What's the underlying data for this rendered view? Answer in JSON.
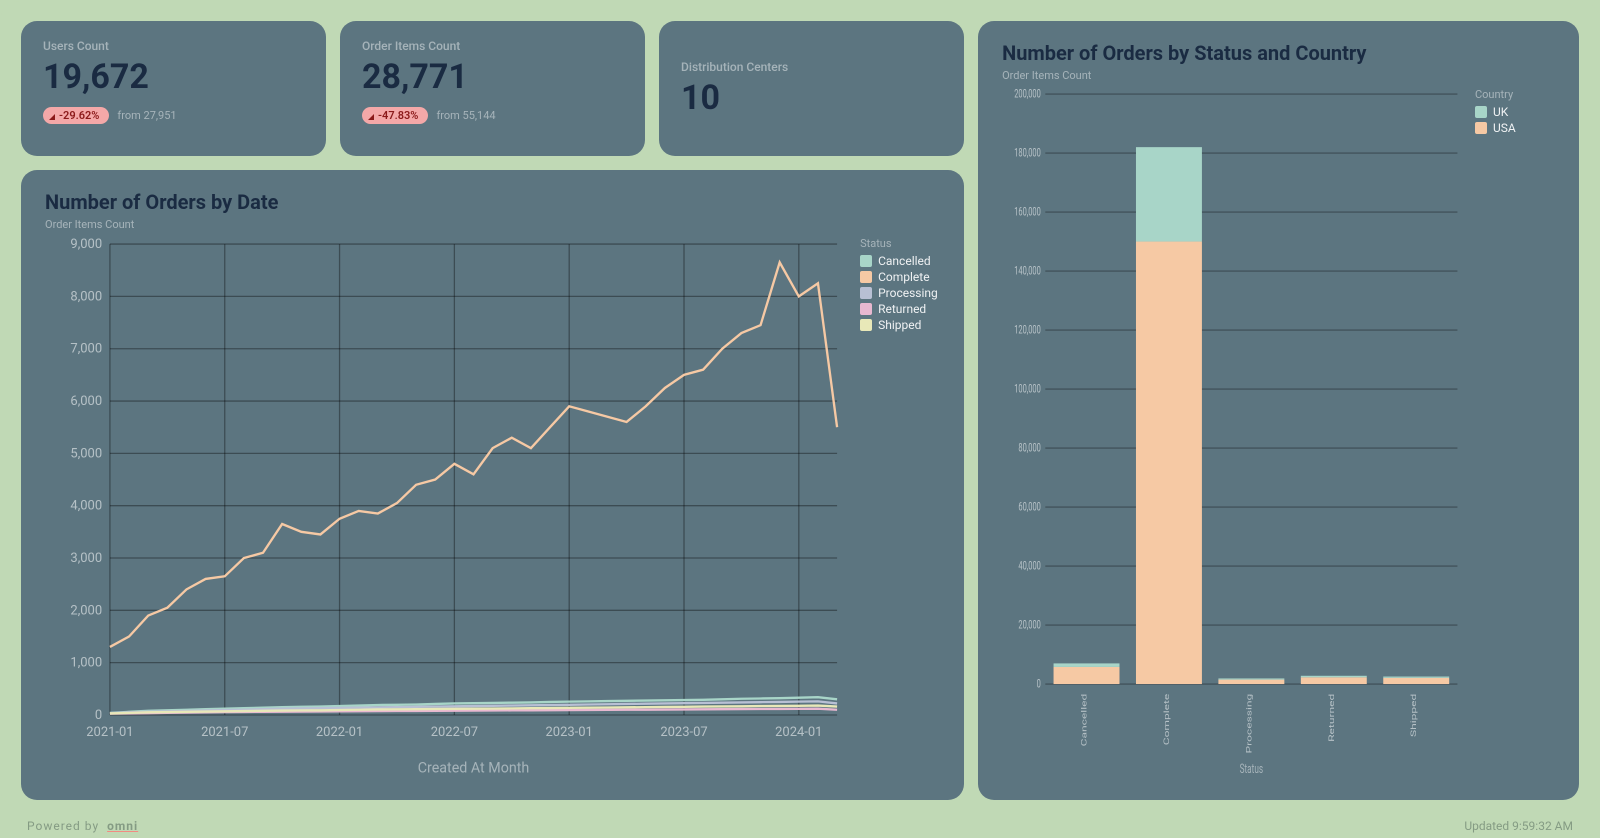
{
  "kpi1": {
    "label": "Users Count",
    "value": "19,672",
    "delta": "-29.62%",
    "from": "from 27,951"
  },
  "kpi2": {
    "label": "Order Items Count",
    "value": "28,771",
    "delta": "-47.83%",
    "from": "from 55,144"
  },
  "kpi3": {
    "label": "Distribution Centers",
    "value": "10"
  },
  "line": {
    "title": "Number of Orders by Date",
    "subtitle": "Order Items Count",
    "xlabel": "Created At Month",
    "legend_title": "Status",
    "legend": [
      "Cancelled",
      "Complete",
      "Processing",
      "Returned",
      "Shipped"
    ]
  },
  "bar": {
    "title": "Number of Orders by Status and Country",
    "subtitle": "Order Items Count",
    "xlabel": "Status",
    "legend_title": "Country",
    "legend": [
      "UK",
      "USA"
    ]
  },
  "footer": {
    "powered": "Powered by",
    "brand": "omni",
    "updated": "Updated 9:59:32 AM"
  },
  "colors": {
    "cancelled": "#a8d5c8",
    "complete": "#f6c9a4",
    "processing": "#b8c0d4",
    "returned": "#e8b8d0",
    "shipped": "#e8e8b8",
    "uk": "#a8d5c8",
    "usa": "#f6c9a4"
  },
  "chart_data": [
    {
      "type": "line",
      "title": "Number of Orders by Date",
      "xlabel": "Created At Month",
      "ylabel": "Order Items Count",
      "ylim": [
        0,
        9000
      ],
      "y_ticks": [
        0,
        1000,
        2000,
        3000,
        4000,
        5000,
        6000,
        7000,
        8000,
        9000
      ],
      "x_ticks": [
        "2021-01",
        "2021-07",
        "2022-01",
        "2022-07",
        "2023-01",
        "2023-07",
        "2024-01"
      ],
      "categories": [
        "2021-01",
        "2021-02",
        "2021-03",
        "2021-04",
        "2021-05",
        "2021-06",
        "2021-07",
        "2021-08",
        "2021-09",
        "2021-10",
        "2021-11",
        "2021-12",
        "2022-01",
        "2022-02",
        "2022-03",
        "2022-04",
        "2022-05",
        "2022-06",
        "2022-07",
        "2022-08",
        "2022-09",
        "2022-10",
        "2022-11",
        "2022-12",
        "2023-01",
        "2023-02",
        "2023-03",
        "2023-04",
        "2023-05",
        "2023-06",
        "2023-07",
        "2023-08",
        "2023-09",
        "2023-10",
        "2023-11",
        "2023-12",
        "2024-01",
        "2024-02",
        "2024-03"
      ],
      "series": [
        {
          "name": "Cancelled",
          "color": "#a8d5c8",
          "values": [
            40,
            60,
            80,
            90,
            100,
            110,
            120,
            130,
            140,
            150,
            155,
            160,
            170,
            180,
            190,
            195,
            200,
            210,
            220,
            225,
            230,
            235,
            240,
            250,
            255,
            260,
            265,
            270,
            275,
            280,
            285,
            290,
            300,
            310,
            315,
            320,
            330,
            340,
            300
          ]
        },
        {
          "name": "Complete",
          "color": "#f6c9a4",
          "values": [
            1300,
            1500,
            1900,
            2050,
            2400,
            2600,
            2650,
            3000,
            3100,
            3650,
            3500,
            3450,
            3750,
            3900,
            3850,
            4050,
            4400,
            4500,
            4800,
            4600,
            5100,
            5300,
            5100,
            5500,
            5900,
            5800,
            5700,
            5600,
            5900,
            6250,
            6500,
            6600,
            7000,
            7300,
            7450,
            8650,
            8000,
            8250,
            5500
          ]
        },
        {
          "name": "Processing",
          "color": "#b8c0d4",
          "values": [
            35,
            50,
            60,
            70,
            75,
            85,
            95,
            100,
            110,
            120,
            125,
            130,
            135,
            140,
            145,
            150,
            155,
            160,
            165,
            170,
            175,
            180,
            185,
            190,
            195,
            200,
            205,
            210,
            215,
            220,
            225,
            230,
            235,
            240,
            245,
            250,
            255,
            260,
            220
          ]
        },
        {
          "name": "Returned",
          "color": "#e8b8d0",
          "values": [
            25,
            30,
            35,
            40,
            45,
            50,
            55,
            58,
            60,
            63,
            65,
            68,
            70,
            72,
            74,
            76,
            78,
            80,
            82,
            84,
            86,
            88,
            90,
            92,
            94,
            96,
            98,
            100,
            102,
            104,
            106,
            108,
            110,
            112,
            114,
            116,
            118,
            120,
            100
          ]
        },
        {
          "name": "Shipped",
          "color": "#e8e8b8",
          "values": [
            30,
            40,
            50,
            55,
            60,
            65,
            70,
            75,
            80,
            85,
            88,
            90,
            95,
            100,
            105,
            108,
            110,
            115,
            118,
            120,
            123,
            126,
            130,
            133,
            136,
            140,
            143,
            146,
            150,
            153,
            156,
            160,
            163,
            166,
            170,
            173,
            176,
            180,
            160
          ]
        }
      ]
    },
    {
      "type": "bar",
      "stacked": true,
      "title": "Number of Orders by Status and Country",
      "xlabel": "Status",
      "ylabel": "Order Items Count",
      "ylim": [
        0,
        200000
      ],
      "y_ticks": [
        0,
        20000,
        40000,
        60000,
        80000,
        100000,
        120000,
        140000,
        160000,
        180000,
        200000
      ],
      "categories": [
        "Cancelled",
        "Complete",
        "Processing",
        "Returned",
        "Shipped"
      ],
      "series": [
        {
          "name": "UK",
          "color": "#a8d5c8",
          "values": [
            1200,
            32000,
            400,
            500,
            450
          ]
        },
        {
          "name": "USA",
          "color": "#f6c9a4",
          "values": [
            5800,
            150000,
            1500,
            2300,
            2100
          ]
        }
      ]
    }
  ]
}
